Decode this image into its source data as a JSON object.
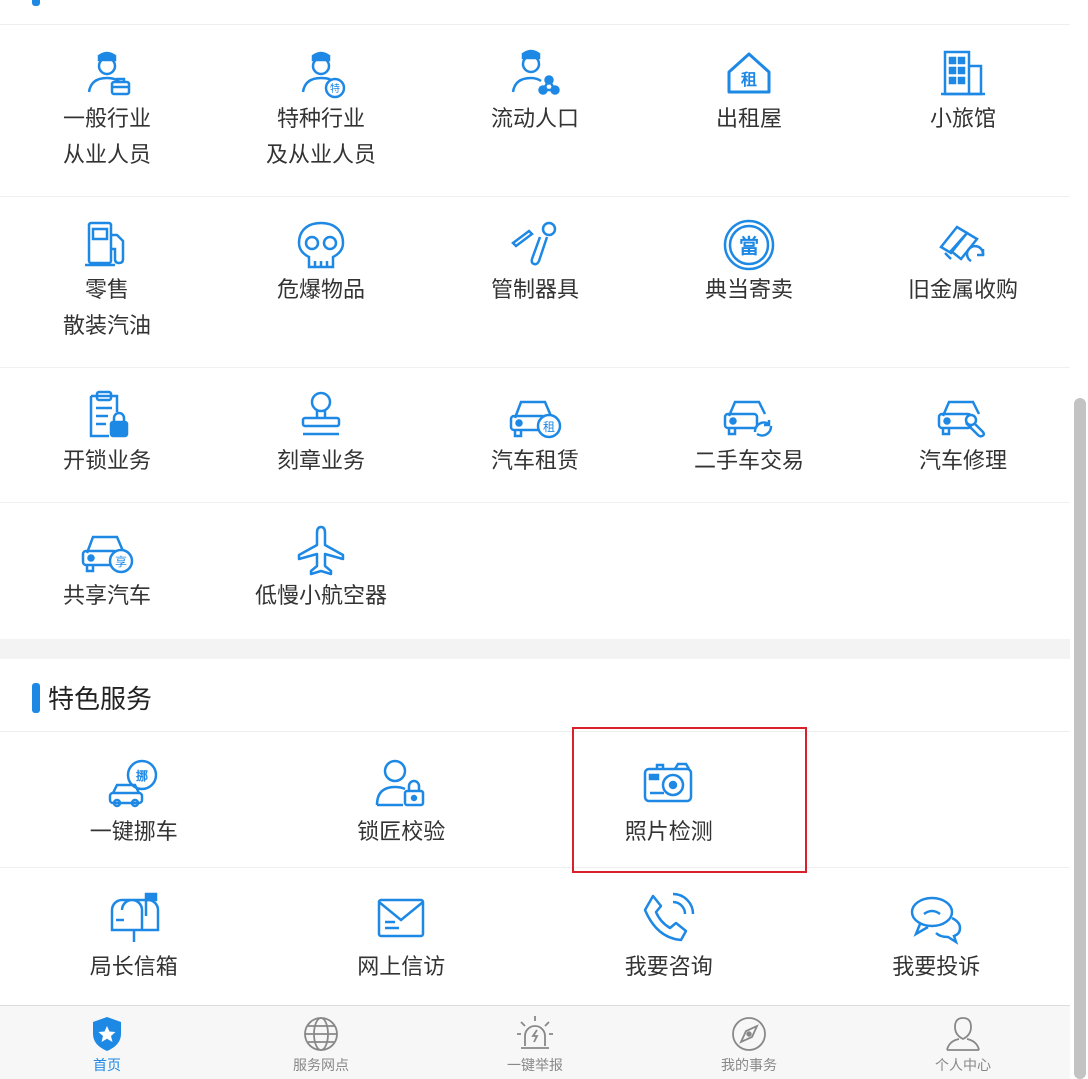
{
  "colors": {
    "accent": "#1e88e5",
    "icon": "#1e88e5",
    "tab_inactive": "#888888",
    "highlight": "#d9212b"
  },
  "section1": {
    "title": "",
    "items": [
      {
        "lines": [
          "一般行业",
          "从业人员"
        ],
        "icon": "person-briefcase-icon"
      },
      {
        "lines": [
          "特种行业",
          "及从业人员"
        ],
        "icon": "person-special-icon"
      },
      {
        "lines": [
          "流动人口",
          ""
        ],
        "icon": "person-network-icon"
      },
      {
        "lines": [
          "出租屋",
          ""
        ],
        "icon": "rental-house-icon"
      },
      {
        "lines": [
          "小旅馆",
          ""
        ],
        "icon": "hotel-building-icon"
      },
      {
        "lines": [
          "零售",
          "散装汽油"
        ],
        "icon": "fuel-pump-icon"
      },
      {
        "lines": [
          "危爆物品",
          ""
        ],
        "icon": "skull-icon"
      },
      {
        "lines": [
          "管制器具",
          ""
        ],
        "icon": "controlled-tool-icon"
      },
      {
        "lines": [
          "典当寄卖",
          ""
        ],
        "icon": "pawn-icon"
      },
      {
        "lines": [
          "旧金属收购",
          ""
        ],
        "icon": "scrap-metal-icon"
      },
      {
        "lines": [
          "开锁业务",
          ""
        ],
        "icon": "clipboard-lock-icon"
      },
      {
        "lines": [
          "刻章业务",
          ""
        ],
        "icon": "stamp-icon"
      },
      {
        "lines": [
          "汽车租赁",
          ""
        ],
        "icon": "car-rent-icon"
      },
      {
        "lines": [
          "二手车交易",
          ""
        ],
        "icon": "car-exchange-icon"
      },
      {
        "lines": [
          "汽车修理",
          ""
        ],
        "icon": "car-repair-icon"
      },
      {
        "lines": [
          "共享汽车",
          ""
        ],
        "icon": "car-share-icon"
      },
      {
        "lines": [
          "低慢小航空器",
          ""
        ],
        "icon": "airplane-icon"
      }
    ]
  },
  "section2": {
    "title": "特色服务",
    "items": [
      {
        "label": "一键挪车",
        "icon": "car-move-icon"
      },
      {
        "label": "锁匠校验",
        "icon": "locksmith-verify-icon"
      },
      {
        "label": "照片检测",
        "icon": "camera-icon"
      },
      {
        "label": "局长信箱",
        "icon": "mailbox-icon"
      },
      {
        "label": "网上信访",
        "icon": "envelope-icon"
      },
      {
        "label": "我要咨询",
        "icon": "phone-call-icon"
      },
      {
        "label": "我要投诉",
        "icon": "chat-bubbles-icon"
      }
    ]
  },
  "tabbar": [
    {
      "label": "首页",
      "icon": "police-badge-icon",
      "active": true
    },
    {
      "label": "服务网点",
      "icon": "globe-icon",
      "active": false
    },
    {
      "label": "一键举报",
      "icon": "alarm-light-icon",
      "active": false
    },
    {
      "label": "我的事务",
      "icon": "compass-icon",
      "active": false
    },
    {
      "label": "个人中心",
      "icon": "user-icon",
      "active": false
    }
  ]
}
